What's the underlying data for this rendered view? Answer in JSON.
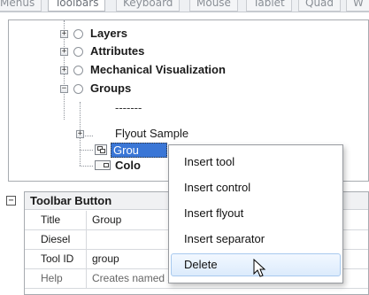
{
  "tabs": [
    "Menus",
    "Toolbars",
    "Keyboard",
    "Mouse",
    "Tablet",
    "Quad",
    "W"
  ],
  "tree": {
    "layers": "Layers",
    "attributes": "Attributes",
    "mechanical": "Mechanical Visualization",
    "groups": "Groups",
    "separator": "-------",
    "flyout_sample": "Flyout Sample",
    "group_item": "Grou",
    "color_item": "Colo"
  },
  "properties": {
    "section": "Toolbar Button",
    "rows": [
      {
        "name": "Title",
        "value": "Group"
      },
      {
        "name": "Diesel",
        "value": ""
      },
      {
        "name": "Tool ID",
        "value": "group"
      },
      {
        "name": "Help",
        "value": "Creates named selection sets of entities"
      }
    ]
  },
  "context_menu": {
    "items": [
      "Insert tool",
      "Insert control",
      "Insert flyout",
      "Insert separator",
      "Delete"
    ],
    "hovered": "Delete"
  }
}
